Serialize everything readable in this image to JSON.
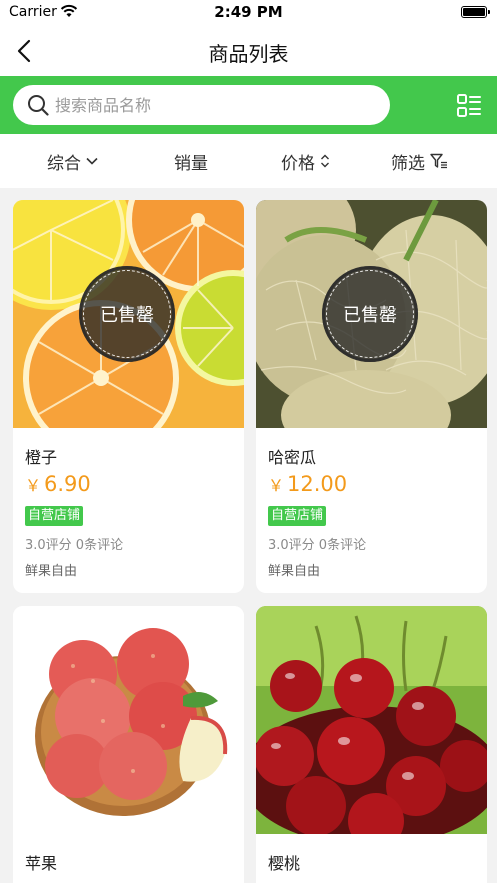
{
  "status_bar": {
    "carrier": "Carrier",
    "time": "2:49 PM"
  },
  "nav": {
    "title": "商品列表"
  },
  "search": {
    "placeholder": "搜索商品名称"
  },
  "sort": {
    "items": [
      {
        "label": "综合"
      },
      {
        "label": "销量"
      },
      {
        "label": "价格"
      },
      {
        "label": "筛选"
      }
    ]
  },
  "colors": {
    "brand_green": "#43c84c",
    "price_orange": "#f39a1b"
  },
  "products": [
    {
      "name": "橙子",
      "currency": "￥",
      "price": "6.90",
      "badge": "自营店铺",
      "rating": "3.0评分  0条评论",
      "shop": "鲜果自由",
      "sold_out": "已售罄"
    },
    {
      "name": "哈密瓜",
      "currency": "￥",
      "price": "12.00",
      "badge": "自营店铺",
      "rating": "3.0评分  0条评论",
      "shop": "鲜果自由",
      "sold_out": "已售罄"
    },
    {
      "name": "苹果"
    },
    {
      "name": "樱桃"
    }
  ]
}
